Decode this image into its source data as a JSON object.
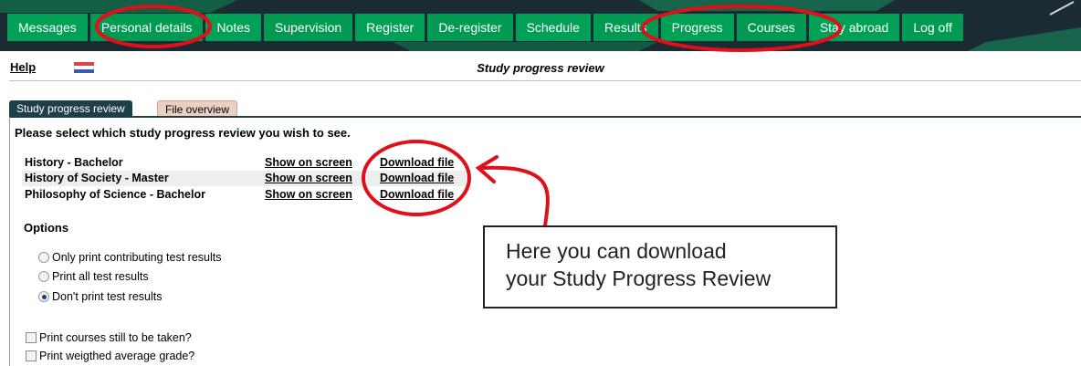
{
  "nav": {
    "items": [
      {
        "label": "Messages"
      },
      {
        "label": "Personal details"
      },
      {
        "label": "Notes"
      },
      {
        "label": "Supervision"
      },
      {
        "label": "Register"
      },
      {
        "label": "De-register"
      },
      {
        "label": "Schedule"
      },
      {
        "label": "Results"
      },
      {
        "label": "Progress"
      },
      {
        "label": "Courses"
      },
      {
        "label": "Stay abroad"
      },
      {
        "label": "Log off"
      }
    ],
    "bg_color": "#1a2b33",
    "item_color": "#009a52"
  },
  "header": {
    "help_label": "Help",
    "flag_icon": "netherlands-flag-icon",
    "title": "Study progress review"
  },
  "tabs": [
    {
      "label": "Study progress review",
      "active": true
    },
    {
      "label": "File overview",
      "active": false
    }
  ],
  "prompt": "Please select which study progress review you wish to see.",
  "programs": [
    {
      "name": "History - Bachelor",
      "show_label": "Show on screen",
      "download_label": "Download file"
    },
    {
      "name": "History of Society - Master",
      "show_label": "Show on screen",
      "download_label": "Download file"
    },
    {
      "name": "Philosophy of Science - Bachelor",
      "show_label": "Show on screen",
      "download_label": "Download file"
    }
  ],
  "options": {
    "title": "Options",
    "radios": [
      {
        "label": "Only print contributing test results",
        "selected": false
      },
      {
        "label": "Print all test results",
        "selected": false
      },
      {
        "label": "Don't print test results",
        "selected": true
      }
    ],
    "checkboxes": [
      {
        "label": "Print courses still to be taken?",
        "checked": false
      },
      {
        "label": "Print weigthed average grade?",
        "checked": false
      }
    ]
  },
  "annotation": {
    "callout_line1": "Here you can download",
    "callout_line2": "your Study Progress Review",
    "circle_color": "#e0101a"
  }
}
